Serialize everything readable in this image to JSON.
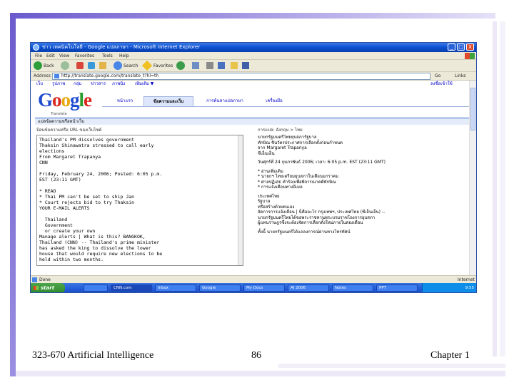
{
  "slide": {
    "footer_left": "323-670 Artificial Intelligence",
    "footer_center": "86",
    "footer_right": "Chapter 1",
    "accent_color": "#6a5acd"
  },
  "browser": {
    "title": "ข่าว เทคนิคโนโลยี - Google แปลภาษา - Microsoft Internet Explorer",
    "window_buttons": [
      "_",
      "□",
      "X"
    ],
    "menu": [
      "File",
      "Edit",
      "View",
      "Favorites",
      "Tools",
      "Help"
    ],
    "toolbar": {
      "back": "Back",
      "search": "Search",
      "favorites": "Favorites"
    },
    "address": {
      "label": "Address",
      "url": "http://translate.google.com/translate_t?hl=th",
      "go": "Go",
      "links": "Links"
    },
    "status": {
      "left": "Done",
      "right": "Internet"
    }
  },
  "google": {
    "nav": [
      "เว็บ",
      "รูปภาพ",
      "กลุ่ม",
      "ข่าวสาร",
      "ภาพนิ่ง",
      "เพิ่มเติม ▼"
    ],
    "signin": "ลงชื่อเข้าใช้",
    "logo_letters": [
      "G",
      "o",
      "o",
      "g",
      "l",
      "e"
    ],
    "logo_sub": "Translate",
    "tabs": [
      "หน้าแรก",
      "ข้อความและเว็บ",
      "การค้นหาแปลภาษา",
      "เครื่องมือ"
    ],
    "active_tab": 1,
    "section_title": "แปลข้อความหรือหน้าเว็บ",
    "source_label": "ป้อนข้อความหรือ URL ของเว็บไซต์",
    "source_text": [
      "Thailand's PM dissolves government",
      "Thaksin Shinawatra stressed to call early",
      "elections",
      "From Margaret Trapanya",
      "CNN",
      "",
      "Friday, February 24, 2006; Posted: 6:05 p.m.",
      "EST (23:11 GMT)",
      "",
      "* READ",
      "* Thai PM can't be set to ship Jan",
      "* Court rejects bid to try Thaksin",
      "YOUR E-MAIL ALERTS",
      "",
      "  Thailand",
      "  Government",
      "  or create your own",
      "Manage alerts | What is this? BANGKOK,",
      "Thailand (CNN) -- Thailand's prime minister",
      "has asked the king to dissolve the lower",
      "house that would require new elections to be",
      "held within two months."
    ],
    "result_label": "การแปล: อังกฤษ > ไทย",
    "result_text": [
      "นายกรัฐมนตรีไทยยุบสภารัฐบาล",
      "ทักษิณ ชินวัตรประกาศการเลือกตั้งก่อนกำหนด",
      "จาก Margaret Trapanya",
      "ซีเอ็นเอ็น",
      "",
      "วันศุกร์ที่ 24 กุมภาพันธ์ 2006; เวลา: 6:05 p.m. EST (23:11 GMT)",
      "",
      "* อ่านเพิ่มเติม",
      "* นายกฯ ไทยเตรียมยุบสภาในเดือนมกราคม",
      "* ศาลปฏิเสธ คำร้องเพื่อพิจารณาคดีทักษิณ",
      "* การแจ้งเตือนทางอีเมล",
      "",
      "  ประเทศไทย",
      "  รัฐบาล",
      "  หรือสร้างด้วยตนเอง",
      "จัดการการแจ้งเตือน | นี่คืออะไร กรุงเทพฯ, ประเทศไทย (ซีเอ็นเอ็น) --",
      "นายกรัฐมนตรีไทยได้ขอพระราชทานพระบรมราชโองการยุบสภา",
      "ผู้แทนราษฎรซึ่งจะต้องจัดการเลือกตั้งใหม่ภายในสองเดือน",
      "",
      "ทั้งนี้ นายกรัฐมนตรีได้แถลงการณ์ผ่านทางโทรทัศน์"
    ]
  },
  "taskbar": {
    "start": "start",
    "tasks": [
      "",
      "CNN.com",
      "Inbox",
      "Google",
      "My Docs",
      "AI 2006",
      "Notes",
      "PPT"
    ],
    "active_task": 1,
    "tray": "9:55"
  }
}
